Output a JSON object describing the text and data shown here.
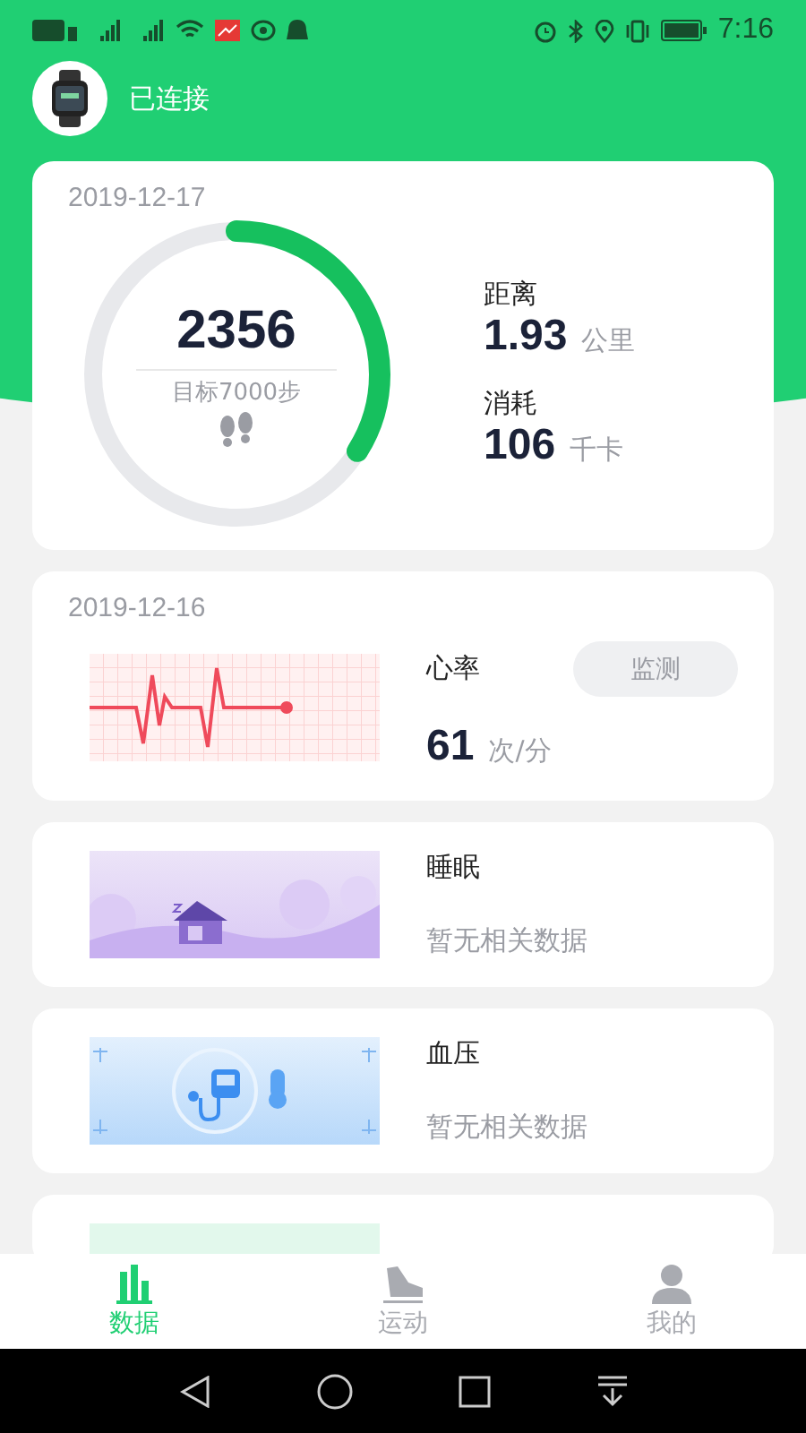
{
  "status_bar": {
    "time": "7:16"
  },
  "header": {
    "status": "已连接"
  },
  "steps_card": {
    "date": "2019-12-17",
    "steps": "2356",
    "goal": "目标7000步",
    "level": 0.34,
    "stats": [
      {
        "label": "距离",
        "value": "1.93",
        "unit": "公里"
      },
      {
        "label": "消耗",
        "value": "106",
        "unit": "千卡"
      }
    ]
  },
  "health_cards": [
    {
      "kind": "heart",
      "date": "2019-12-16",
      "title": "心率",
      "value": "61",
      "unit": "次/分",
      "button": {
        "label": "监测",
        "disabled": true
      }
    },
    {
      "kind": "sleep",
      "title": "睡眠",
      "note": "暂无相关数据"
    },
    {
      "kind": "pressure",
      "title": "血压",
      "note": "暂无相关数据"
    },
    {
      "kind": "partial"
    }
  ],
  "tabs": [
    {
      "kind": "data",
      "label": "数据",
      "selected": true
    },
    {
      "kind": "sport",
      "label": "运动",
      "selected": false
    },
    {
      "kind": "profile",
      "label": "我的",
      "selected": false
    }
  ]
}
